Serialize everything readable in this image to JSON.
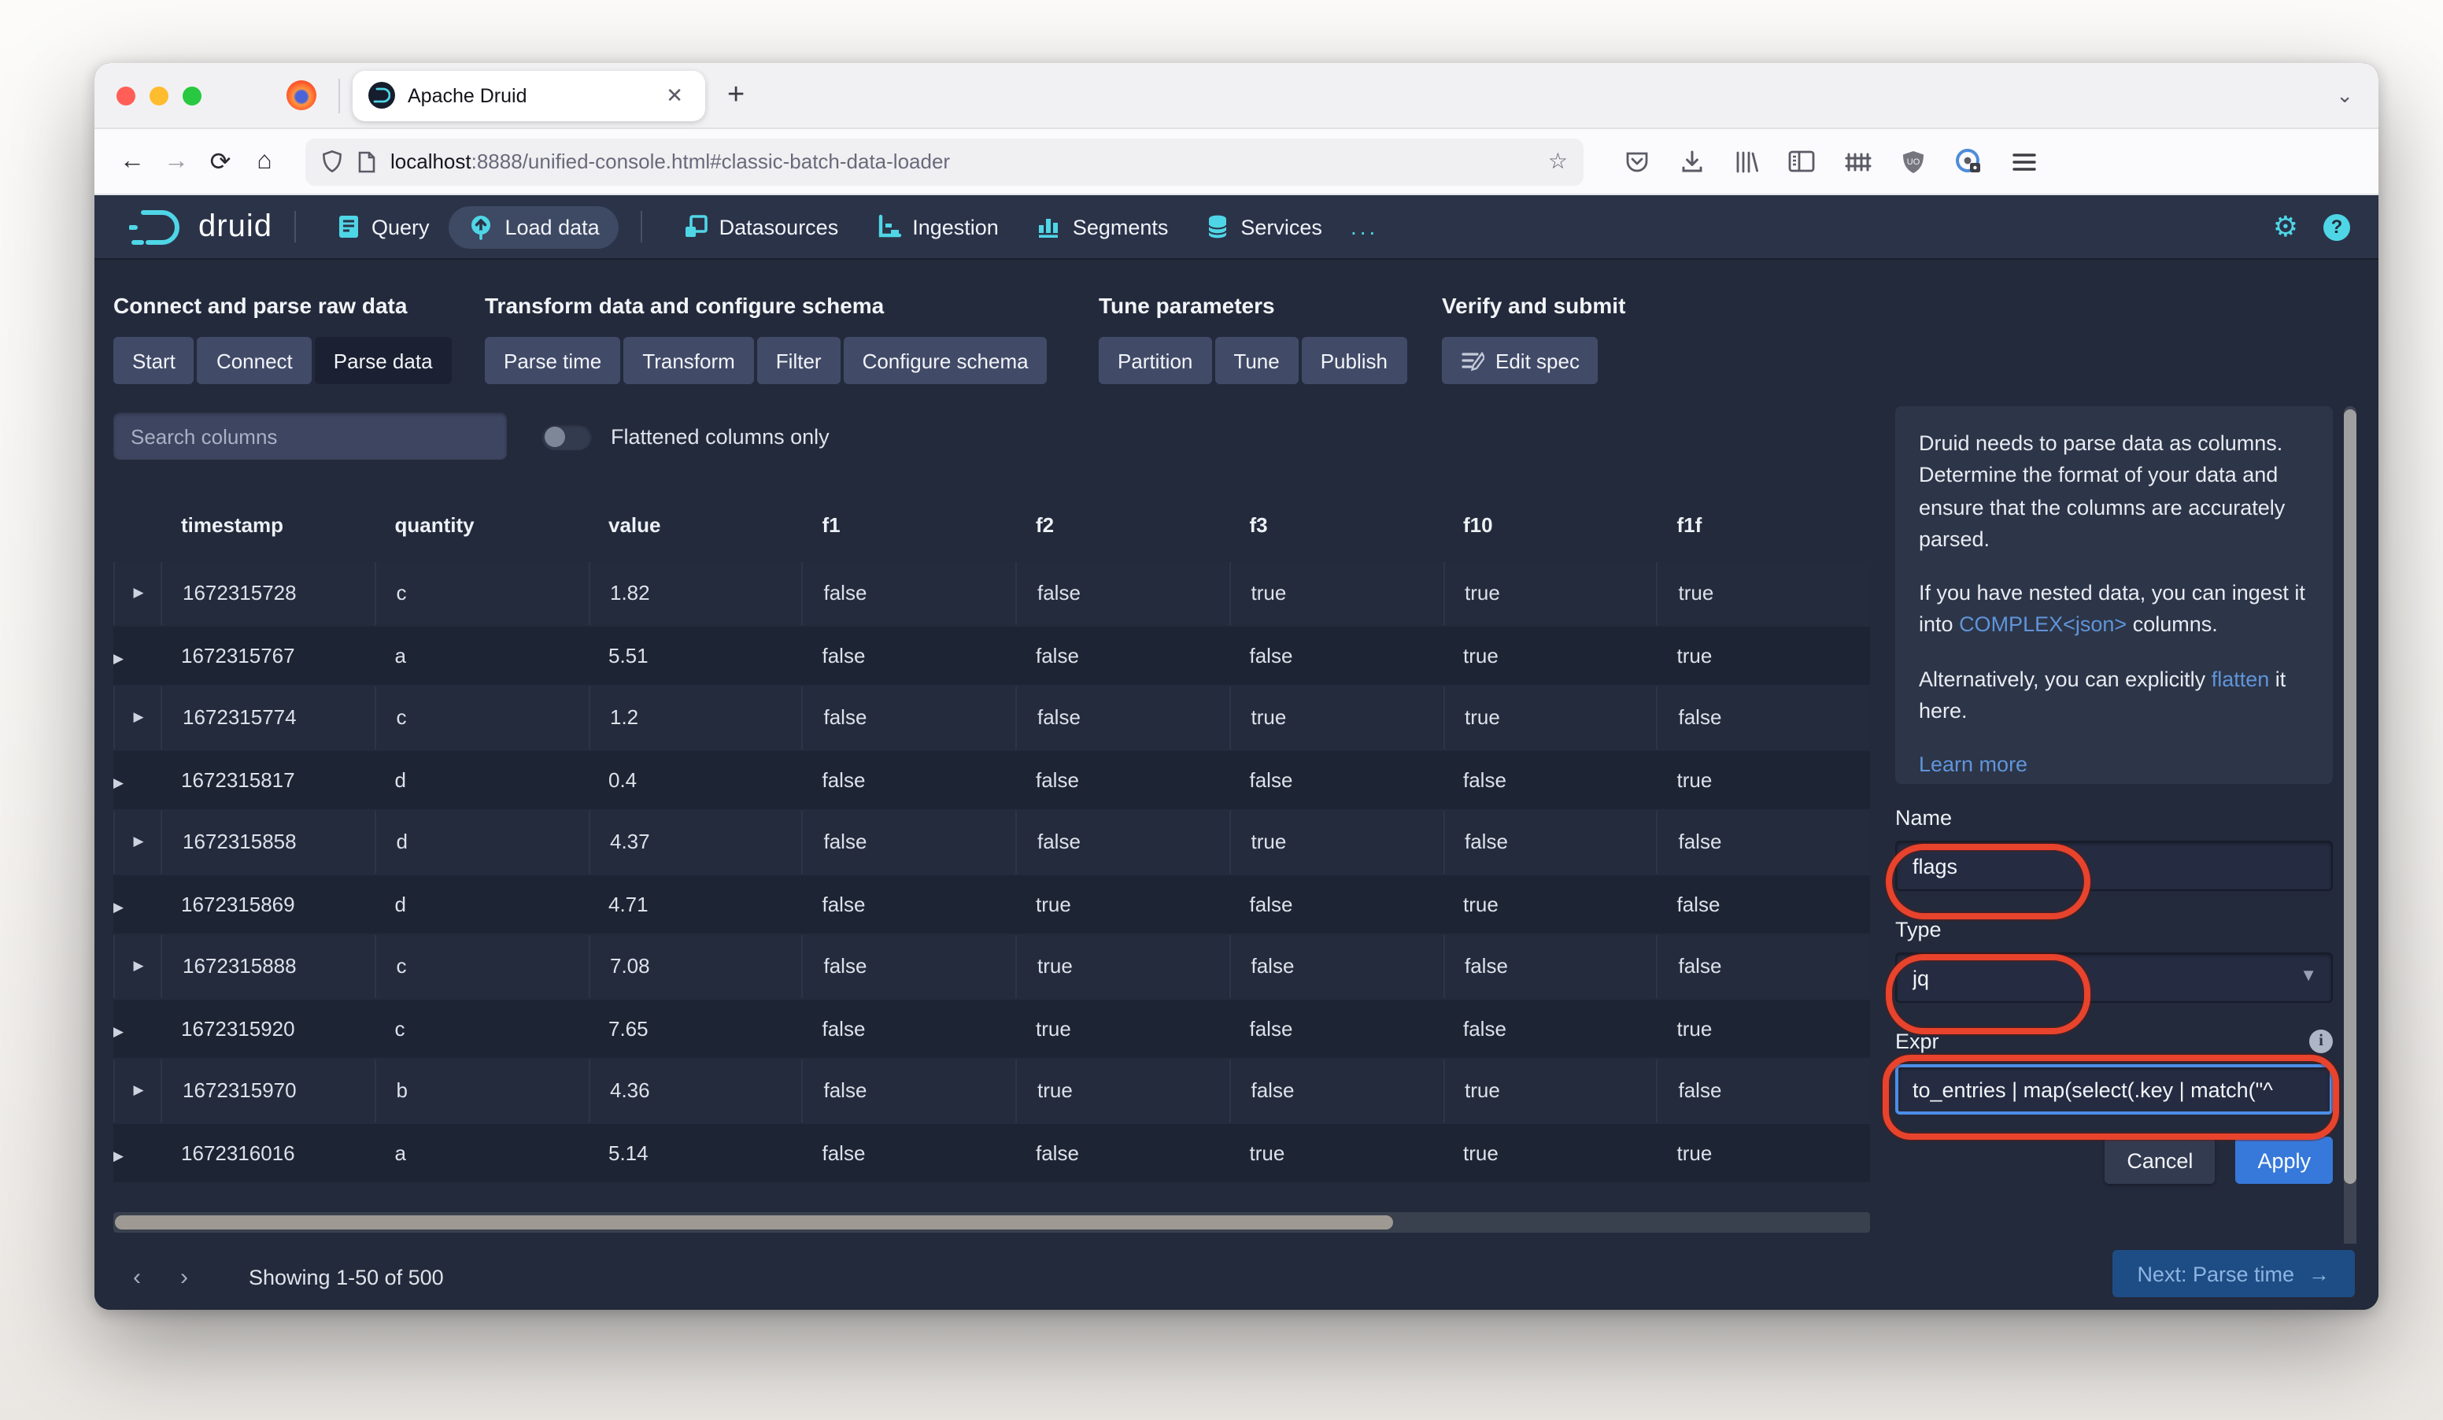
{
  "browser": {
    "tab": {
      "title": "Apache Druid"
    },
    "url": {
      "host": "localhost",
      "path": ":8888/unified-console.html#classic-batch-data-loader"
    }
  },
  "navbar": {
    "brand": "druid",
    "items": [
      {
        "label": "Query"
      },
      {
        "label": "Load data",
        "active": true
      },
      {
        "label": "Datasources"
      },
      {
        "label": "Ingestion"
      },
      {
        "label": "Segments"
      },
      {
        "label": "Services"
      },
      {
        "label": "..."
      }
    ]
  },
  "steps": {
    "groups": [
      {
        "title": "Connect and parse raw data",
        "buttons": [
          {
            "label": "Start"
          },
          {
            "label": "Connect"
          },
          {
            "label": "Parse data",
            "active": true
          }
        ]
      },
      {
        "title": "Transform data and configure schema",
        "buttons": [
          {
            "label": "Parse time"
          },
          {
            "label": "Transform"
          },
          {
            "label": "Filter"
          },
          {
            "label": "Configure schema"
          }
        ]
      },
      {
        "title": "Tune parameters",
        "buttons": [
          {
            "label": "Partition"
          },
          {
            "label": "Tune"
          },
          {
            "label": "Publish"
          }
        ]
      },
      {
        "title": "Verify and submit",
        "buttons": [
          {
            "label": "Edit spec"
          }
        ]
      }
    ]
  },
  "filters": {
    "search_placeholder": "Search columns",
    "toggle_label": "Flattened columns only"
  },
  "table": {
    "columns": [
      "timestamp",
      "quantity",
      "value",
      "f1",
      "f2",
      "f3",
      "f10",
      "f1f"
    ],
    "rows": [
      [
        "1672315728",
        "c",
        "1.82",
        "false",
        "false",
        "true",
        "true",
        "true"
      ],
      [
        "1672315767",
        "a",
        "5.51",
        "false",
        "false",
        "false",
        "true",
        "true"
      ],
      [
        "1672315774",
        "c",
        "1.2",
        "false",
        "false",
        "true",
        "true",
        "false"
      ],
      [
        "1672315817",
        "d",
        "0.4",
        "false",
        "false",
        "false",
        "false",
        "true"
      ],
      [
        "1672315858",
        "d",
        "4.37",
        "false",
        "false",
        "true",
        "false",
        "false"
      ],
      [
        "1672315869",
        "d",
        "4.71",
        "false",
        "true",
        "false",
        "true",
        "false"
      ],
      [
        "1672315888",
        "c",
        "7.08",
        "false",
        "true",
        "false",
        "false",
        "false"
      ],
      [
        "1672315920",
        "c",
        "7.65",
        "false",
        "true",
        "false",
        "false",
        "true"
      ],
      [
        "1672315970",
        "b",
        "4.36",
        "false",
        "true",
        "false",
        "true",
        "false"
      ],
      [
        "1672316016",
        "a",
        "5.14",
        "false",
        "false",
        "true",
        "true",
        "true"
      ]
    ]
  },
  "pagination": {
    "summary": "Showing 1-50 of 500"
  },
  "help": {
    "p1": "Druid needs to parse data as columns. Determine the format of your data and ensure that the columns are accurately parsed.",
    "p2_a": "If you have nested data, you can ingest it into ",
    "p2_link": "COMPLEX<json>",
    "p2_b": " columns.",
    "p3_a": "Alternatively, you can explicitly ",
    "p3_link": "flatten",
    "p3_b": " it here.",
    "learn_more": "Learn more"
  },
  "form": {
    "name_label": "Name",
    "name_value": "flags",
    "type_label": "Type",
    "type_value": "jq",
    "expr_label": "Expr",
    "expr_value": "to_entries | map(select(.key | match(\"^",
    "cancel_label": "Cancel",
    "apply_label": "Apply"
  },
  "footer": {
    "next_label": "Next: Parse time"
  },
  "colors": {
    "accent_cyan": "#4fd6e6",
    "apply_blue": "#3679da",
    "annotation_red": "#e8432c"
  }
}
